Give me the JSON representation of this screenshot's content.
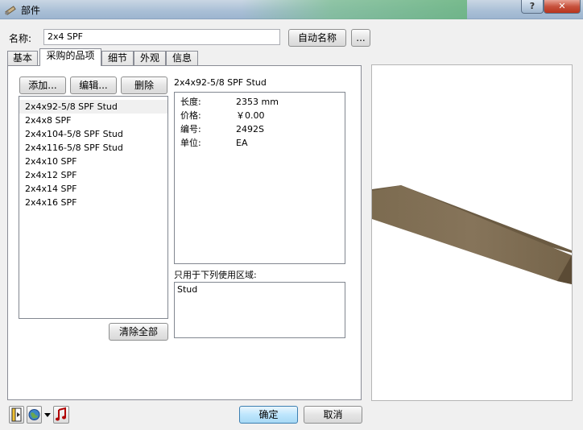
{
  "window": {
    "title": "部件",
    "help_label": "?",
    "close_label": "✕"
  },
  "name_row": {
    "label": "名称:",
    "value": "2x4 SPF",
    "auto_name_label": "自动名称",
    "browse_label": "..."
  },
  "tabs": [
    {
      "label": "基本"
    },
    {
      "label": "采购的品项"
    },
    {
      "label": "细节"
    },
    {
      "label": "外观"
    },
    {
      "label": "信息"
    }
  ],
  "actions": {
    "add_label": "添加...",
    "edit_label": "编辑...",
    "delete_label": "删除",
    "clear_all_label": "清除全部"
  },
  "items": [
    {
      "label": "2x4x92-5/8 SPF Stud"
    },
    {
      "label": "2x4x8 SPF"
    },
    {
      "label": "2x4x104-5/8 SPF Stud"
    },
    {
      "label": "2x4x116-5/8 SPF Stud"
    },
    {
      "label": "2x4x10 SPF"
    },
    {
      "label": "2x4x12 SPF"
    },
    {
      "label": "2x4x14 SPF"
    },
    {
      "label": "2x4x16 SPF"
    }
  ],
  "details": {
    "title": "2x4x92-5/8 SPF Stud",
    "properties": [
      {
        "key": "长度:",
        "value": "2353 mm"
      },
      {
        "key": "价格:",
        "value": "￥0.00"
      },
      {
        "key": "编号:",
        "value": "2492S"
      },
      {
        "key": "单位:",
        "value": "EA"
      }
    ]
  },
  "usage": {
    "label": "只用于下列使用区域:",
    "value": "Stud"
  },
  "footer": {
    "ok_label": "确定",
    "cancel_label": "取消"
  },
  "colors": {
    "wood_top": "#7a6a50",
    "wood_side": "#5e4e38"
  },
  "icons": [
    "app-icon",
    "page-icon",
    "globe-icon",
    "dropdown-arrow-icon",
    "music-note-icon"
  ]
}
